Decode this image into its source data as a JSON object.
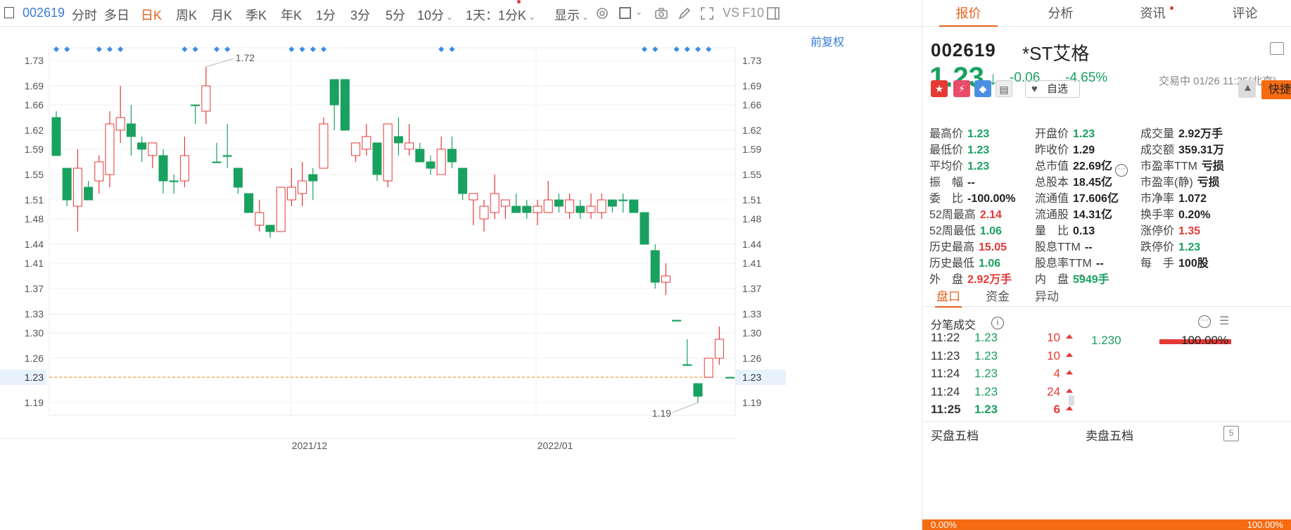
{
  "toolbar": {
    "stock_code": "002619",
    "periods": [
      "分时",
      "多日",
      "日K",
      "周K",
      "月K",
      "季K",
      "年K",
      "1分",
      "3分",
      "5分",
      "10分"
    ],
    "active_period": "日K",
    "range_select": "1天：1分K",
    "display_select": "显示",
    "ws_label": "VS",
    "f10_label": "F10"
  },
  "chart": {
    "adjust_label": "前复权",
    "current_price_label": "1.23",
    "max_label": "1.72",
    "min_label": "1.19",
    "x_labels": [
      "2021/12",
      "2022/01"
    ]
  },
  "chart_data": {
    "type": "candlestick",
    "ylim": [
      1.17,
      1.75
    ],
    "y_ticks": [
      1.73,
      1.69,
      1.66,
      1.62,
      1.59,
      1.55,
      1.51,
      1.48,
      1.44,
      1.41,
      1.37,
      1.33,
      1.3,
      1.26,
      1.23,
      1.19
    ],
    "candles": [
      {
        "o": 1.64,
        "h": 1.65,
        "l": 1.58,
        "c": 1.58
      },
      {
        "o": 1.56,
        "h": 1.56,
        "l": 1.5,
        "c": 1.51
      },
      {
        "o": 1.5,
        "h": 1.59,
        "l": 1.46,
        "c": 1.56
      },
      {
        "o": 1.53,
        "h": 1.54,
        "l": 1.51,
        "c": 1.51
      },
      {
        "o": 1.54,
        "h": 1.58,
        "l": 1.52,
        "c": 1.57
      },
      {
        "o": 1.55,
        "h": 1.65,
        "l": 1.53,
        "c": 1.63
      },
      {
        "o": 1.62,
        "h": 1.69,
        "l": 1.6,
        "c": 1.64
      },
      {
        "o": 1.63,
        "h": 1.66,
        "l": 1.58,
        "c": 1.61
      },
      {
        "o": 1.6,
        "h": 1.61,
        "l": 1.57,
        "c": 1.59
      },
      {
        "o": 1.58,
        "h": 1.6,
        "l": 1.56,
        "c": 1.6
      },
      {
        "o": 1.58,
        "h": 1.59,
        "l": 1.52,
        "c": 1.54
      },
      {
        "o": 1.54,
        "h": 1.55,
        "l": 1.52,
        "c": 1.54
      },
      {
        "o": 1.54,
        "h": 1.61,
        "l": 1.53,
        "c": 1.58
      },
      {
        "o": 1.66,
        "h": 1.66,
        "l": 1.63,
        "c": 1.66
      },
      {
        "o": 1.65,
        "h": 1.72,
        "l": 1.63,
        "c": 1.69
      },
      {
        "o": 1.57,
        "h": 1.6,
        "l": 1.57,
        "c": 1.57
      },
      {
        "o": 1.58,
        "h": 1.63,
        "l": 1.56,
        "c": 1.58
      },
      {
        "o": 1.56,
        "h": 1.56,
        "l": 1.52,
        "c": 1.53
      },
      {
        "o": 1.52,
        "h": 1.52,
        "l": 1.49,
        "c": 1.49
      },
      {
        "o": 1.47,
        "h": 1.51,
        "l": 1.46,
        "c": 1.49
      },
      {
        "o": 1.47,
        "h": 1.47,
        "l": 1.45,
        "c": 1.46
      },
      {
        "o": 1.46,
        "h": 1.53,
        "l": 1.46,
        "c": 1.53
      },
      {
        "o": 1.51,
        "h": 1.56,
        "l": 1.5,
        "c": 1.53
      },
      {
        "o": 1.52,
        "h": 1.57,
        "l": 1.5,
        "c": 1.54
      },
      {
        "o": 1.55,
        "h": 1.56,
        "l": 1.51,
        "c": 1.54
      },
      {
        "o": 1.56,
        "h": 1.64,
        "l": 1.56,
        "c": 1.63
      },
      {
        "o": 1.7,
        "h": 1.7,
        "l": 1.62,
        "c": 1.66
      },
      {
        "o": 1.7,
        "h": 1.7,
        "l": 1.62,
        "c": 1.62
      },
      {
        "o": 1.58,
        "h": 1.6,
        "l": 1.57,
        "c": 1.6
      },
      {
        "o": 1.59,
        "h": 1.63,
        "l": 1.58,
        "c": 1.61
      },
      {
        "o": 1.6,
        "h": 1.6,
        "l": 1.54,
        "c": 1.55
      },
      {
        "o": 1.54,
        "h": 1.63,
        "l": 1.53,
        "c": 1.63
      },
      {
        "o": 1.61,
        "h": 1.64,
        "l": 1.58,
        "c": 1.6
      },
      {
        "o": 1.59,
        "h": 1.63,
        "l": 1.58,
        "c": 1.6
      },
      {
        "o": 1.59,
        "h": 1.6,
        "l": 1.57,
        "c": 1.57
      },
      {
        "o": 1.57,
        "h": 1.58,
        "l": 1.55,
        "c": 1.56
      },
      {
        "o": 1.55,
        "h": 1.61,
        "l": 1.55,
        "c": 1.59
      },
      {
        "o": 1.59,
        "h": 1.61,
        "l": 1.56,
        "c": 1.57
      },
      {
        "o": 1.56,
        "h": 1.56,
        "l": 1.51,
        "c": 1.52
      },
      {
        "o": 1.51,
        "h": 1.52,
        "l": 1.47,
        "c": 1.52
      },
      {
        "o": 1.48,
        "h": 1.51,
        "l": 1.46,
        "c": 1.5
      },
      {
        "o": 1.49,
        "h": 1.55,
        "l": 1.48,
        "c": 1.52
      },
      {
        "o": 1.5,
        "h": 1.51,
        "l": 1.48,
        "c": 1.51
      },
      {
        "o": 1.5,
        "h": 1.52,
        "l": 1.49,
        "c": 1.49
      },
      {
        "o": 1.5,
        "h": 1.51,
        "l": 1.48,
        "c": 1.49
      },
      {
        "o": 1.49,
        "h": 1.51,
        "l": 1.47,
        "c": 1.5
      },
      {
        "o": 1.49,
        "h": 1.54,
        "l": 1.49,
        "c": 1.51
      },
      {
        "o": 1.51,
        "h": 1.52,
        "l": 1.49,
        "c": 1.5
      },
      {
        "o": 1.49,
        "h": 1.52,
        "l": 1.48,
        "c": 1.51
      },
      {
        "o": 1.5,
        "h": 1.51,
        "l": 1.48,
        "c": 1.49
      },
      {
        "o": 1.49,
        "h": 1.52,
        "l": 1.48,
        "c": 1.5
      },
      {
        "o": 1.49,
        "h": 1.52,
        "l": 1.48,
        "c": 1.51
      },
      {
        "o": 1.51,
        "h": 1.51,
        "l": 1.49,
        "c": 1.5
      },
      {
        "o": 1.51,
        "h": 1.52,
        "l": 1.49,
        "c": 1.51
      },
      {
        "o": 1.51,
        "h": 1.51,
        "l": 1.49,
        "c": 1.49
      },
      {
        "o": 1.49,
        "h": 1.49,
        "l": 1.44,
        "c": 1.44
      },
      {
        "o": 1.43,
        "h": 1.44,
        "l": 1.37,
        "c": 1.38
      },
      {
        "o": 1.38,
        "h": 1.41,
        "l": 1.36,
        "c": 1.39
      },
      {
        "o": 1.32,
        "h": 1.32,
        "l": 1.32,
        "c": 1.32
      },
      {
        "o": 1.25,
        "h": 1.29,
        "l": 1.25,
        "c": 1.25
      },
      {
        "o": 1.22,
        "h": 1.22,
        "l": 1.19,
        "c": 1.2
      },
      {
        "o": 1.23,
        "h": 1.26,
        "l": 1.23,
        "c": 1.26
      },
      {
        "o": 1.26,
        "h": 1.31,
        "l": 1.25,
        "c": 1.29
      },
      {
        "o": 1.23,
        "h": 1.23,
        "l": 1.23,
        "c": 1.23
      }
    ]
  },
  "panel": {
    "tabs": [
      "报价",
      "分析",
      "资讯",
      "评论"
    ],
    "active_tab": "报价",
    "code": "002619",
    "name": "*ST艾格",
    "price": "1.23",
    "change": "-0.06",
    "change_pct": "-4.65%",
    "trade_status": "交易中 01/26 11:25(北京)",
    "fav_label": "自选",
    "quick_trade_label": "快捷交易",
    "quote_rows": [
      [
        {
          "label": "最高价",
          "value": "1.23",
          "color": "green"
        },
        {
          "label": "开盘价",
          "value": "1.23",
          "color": "green"
        },
        {
          "label": "成交量",
          "value": "2.92万手",
          "color": "dark"
        }
      ],
      [
        {
          "label": "最低价",
          "value": "1.23",
          "color": "green"
        },
        {
          "label": "昨收价",
          "value": "1.29",
          "color": "dark"
        },
        {
          "label": "成交额",
          "value": "359.31万",
          "color": "dark"
        }
      ],
      [
        {
          "label": "平均价",
          "value": "1.23",
          "color": "green"
        },
        {
          "label": "总市值",
          "value": "22.69亿",
          "color": "dark"
        },
        {
          "label": "市盈率TTM",
          "value": "亏损",
          "color": "dark"
        }
      ],
      [
        {
          "label": "振　幅",
          "value": "--",
          "color": "dark"
        },
        {
          "label": "总股本",
          "value": "18.45亿",
          "color": "dark"
        },
        {
          "label": "市盈率(静)",
          "value": "亏损",
          "color": "dark"
        }
      ],
      [
        {
          "label": "委　比",
          "value": "-100.00%",
          "color": "dark"
        },
        {
          "label": "流通值",
          "value": "17.606亿",
          "color": "dark"
        },
        {
          "label": "市净率",
          "value": "1.072",
          "color": "dark"
        }
      ],
      [
        {
          "label": "52周最高",
          "value": "2.14",
          "color": "red"
        },
        {
          "label": "流通股",
          "value": "14.31亿",
          "color": "dark"
        },
        {
          "label": "换手率",
          "value": "0.20%",
          "color": "dark"
        }
      ],
      [
        {
          "label": "52周最低",
          "value": "1.06",
          "color": "green"
        },
        {
          "label": "量　比",
          "value": "0.13",
          "color": "dark"
        },
        {
          "label": "涨停价",
          "value": "1.35",
          "color": "red"
        }
      ],
      [
        {
          "label": "历史最高",
          "value": "15.05",
          "color": "red"
        },
        {
          "label": "股息TTM",
          "value": "--",
          "color": "dark"
        },
        {
          "label": "跌停价",
          "value": "1.23",
          "color": "green"
        }
      ],
      [
        {
          "label": "历史最低",
          "value": "1.06",
          "color": "green"
        },
        {
          "label": "股息率TTM",
          "value": "--",
          "color": "dark"
        },
        {
          "label": "每　手",
          "value": "100股",
          "color": "dark"
        }
      ],
      [
        {
          "label": "外　盘",
          "value": "2.92万手",
          "color": "red"
        },
        {
          "label": "内　盘",
          "value": "5949手",
          "color": "green"
        }
      ]
    ],
    "sub_tabs": [
      "盘口",
      "资金",
      "异动"
    ],
    "active_sub_tab": "盘口",
    "ticks_title": "分笔成交",
    "ticks": [
      {
        "time": "11:22",
        "price": "1.23",
        "vol": "10"
      },
      {
        "time": "11:23",
        "price": "1.23",
        "vol": "10"
      },
      {
        "time": "11:24",
        "price": "1.23",
        "vol": "4"
      },
      {
        "time": "11:24",
        "price": "1.23",
        "vol": "24"
      },
      {
        "time": "11:25",
        "price": "1.23",
        "vol": "6"
      }
    ],
    "dist_price": "1.230",
    "dist_pct": "100.00%",
    "buy5": "买盘五档",
    "sell5": "卖盘五档",
    "ratio_left": "0.00%",
    "ratio_right": "100.00%"
  },
  "colors": {
    "up": "#e53935",
    "down": "#19a15f",
    "accent": "#e8611c",
    "link": "#3a7bd5"
  }
}
